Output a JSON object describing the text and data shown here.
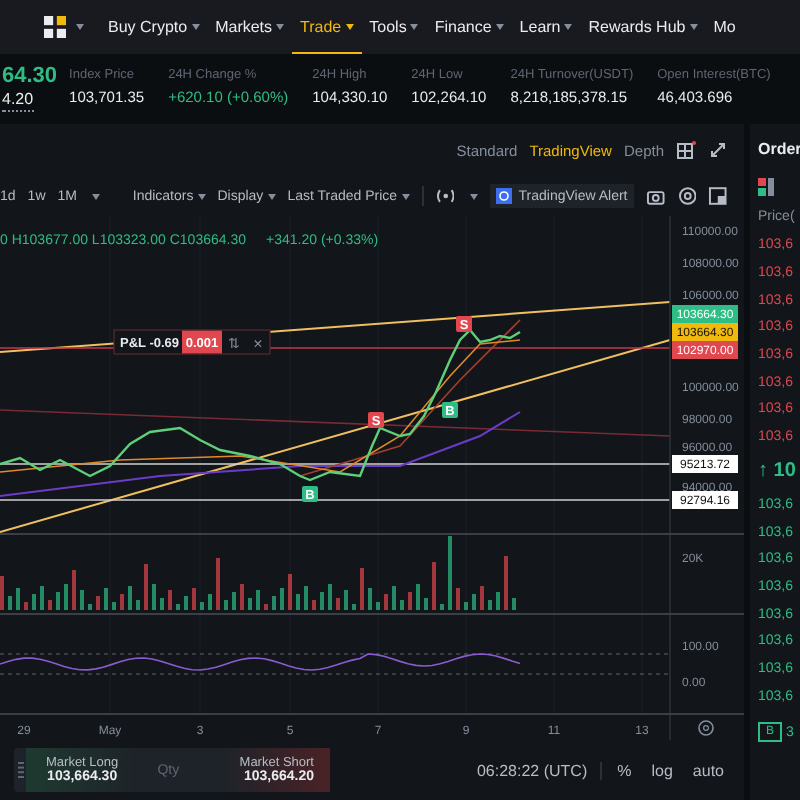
{
  "nav": {
    "items": [
      {
        "label": "Buy Crypto",
        "selected": false
      },
      {
        "label": "Markets",
        "selected": false
      },
      {
        "label": "Trade",
        "selected": true
      },
      {
        "label": "Tools",
        "selected": false
      },
      {
        "label": "Finance",
        "selected": false
      },
      {
        "label": "Learn",
        "selected": false
      },
      {
        "label": "Rewards Hub",
        "selected": false
      }
    ],
    "cut_item": "Mo"
  },
  "ticker": {
    "last_price": "64.30",
    "mark_price": "4.20",
    "stats": [
      {
        "label": "Index Price",
        "value": "103,701.35",
        "kind": "plain"
      },
      {
        "label": "24H Change %",
        "value": "+620.10 (+0.60%)",
        "kind": "up"
      },
      {
        "label": "24H High",
        "value": "104,330.10",
        "kind": "plain"
      },
      {
        "label": "24H Low",
        "value": "102,264.10",
        "kind": "plain"
      },
      {
        "label": "24H Turnover(USDT)",
        "value": "8,218,185,378.15",
        "kind": "plain"
      },
      {
        "label": "Open Interest(BTC)",
        "value": "46,403.696",
        "kind": "plain"
      }
    ]
  },
  "chart_views": [
    {
      "label": "Standard",
      "selected": false
    },
    {
      "label": "TradingView",
      "selected": true
    },
    {
      "label": "Depth",
      "selected": false
    }
  ],
  "toolbar": {
    "intervals": [
      "1d",
      "1w",
      "1M"
    ],
    "menus": [
      "Indicators",
      "Display",
      "Last Traded Price"
    ],
    "alert": "TradingView Alert"
  },
  "chart": {
    "ohlc": "0 H103677.00 L103323.00 C103664.30",
    "change": "+341.20 (+0.33%)",
    "price_axis": [
      "110000.00",
      "108000.00",
      "106000.00",
      "100000.00",
      "98000.00",
      "96000.00",
      "94000.00"
    ],
    "price_tags": [
      {
        "value": "103664.30",
        "color": "#2ebd85"
      },
      {
        "value": "103664.30",
        "color": "#f0b90b"
      },
      {
        "value": "102970.00",
        "color": "#e0474f"
      },
      {
        "value": "95213.72",
        "color": "#ffffff"
      },
      {
        "value": "92794.16",
        "color": "#ffffff"
      }
    ],
    "position": {
      "pnl": "P&L -0.69",
      "qty": "0.001",
      "reverse": "⇅",
      "close": "×"
    },
    "markers": [
      {
        "label": "S",
        "kind": "sell"
      },
      {
        "label": "S",
        "kind": "sell"
      },
      {
        "label": "B",
        "kind": "buy"
      },
      {
        "label": "B",
        "kind": "buy"
      }
    ],
    "volume_axis": "20K",
    "rsi_axis": [
      "100.00",
      "0.00"
    ],
    "time_axis": [
      "29",
      "May",
      "3",
      "5",
      "7",
      "9",
      "11",
      "13"
    ]
  },
  "trade_bar": {
    "long_label": "Market Long",
    "long_price": "103,664.30",
    "qty_placeholder": "Qty",
    "short_label": "Market Short",
    "short_price": "103,664.20"
  },
  "status": {
    "time": "06:28:22 (UTC)",
    "options": [
      "%",
      "log",
      "auto"
    ]
  },
  "order_book": {
    "title": "Order",
    "price_header": "Price(",
    "asks": [
      "103,6",
      "103,6",
      "103,6",
      "103,6",
      "103,6",
      "103,6",
      "103,6",
      "103,6"
    ],
    "last": "↑ 10",
    "bids": [
      "103,6",
      "103,6",
      "103,6",
      "103,6",
      "103,6",
      "103,6",
      "103,6",
      "103,6"
    ],
    "footer_button": "B",
    "footer_count": "3"
  }
}
